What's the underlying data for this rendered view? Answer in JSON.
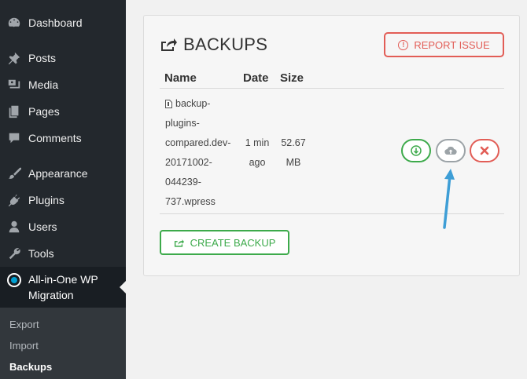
{
  "sidebar": {
    "items": [
      {
        "label": "Dashboard",
        "icon": "dashboard-icon"
      },
      {
        "label": "Posts",
        "icon": "pin-icon"
      },
      {
        "label": "Media",
        "icon": "media-icon"
      },
      {
        "label": "Pages",
        "icon": "pages-icon"
      },
      {
        "label": "Comments",
        "icon": "comment-icon"
      },
      {
        "label": "Appearance",
        "icon": "brush-icon"
      },
      {
        "label": "Plugins",
        "icon": "plugin-icon"
      },
      {
        "label": "Users",
        "icon": "user-icon"
      },
      {
        "label": "Tools",
        "icon": "wrench-icon"
      }
    ],
    "migration": {
      "label_line1": "All-in-One WP",
      "label_line2": "Migration",
      "icon": "migration-icon"
    },
    "submenu": [
      {
        "label": "Export"
      },
      {
        "label": "Import"
      },
      {
        "label": "Backups",
        "current": true
      }
    ]
  },
  "panel": {
    "title": "BACKUPS",
    "report_label": "REPORT ISSUE",
    "report_icon_glyph": "!",
    "columns": [
      "Name",
      "Date",
      "Size"
    ],
    "backup": {
      "name_lines": [
        "backup-",
        "plugins-",
        "compared.dev-",
        "20171002-",
        "044239-",
        "737.wpress"
      ],
      "date_lines": [
        "1 min",
        "ago"
      ],
      "size_lines": [
        "52.67",
        "MB"
      ]
    },
    "create_label": "CREATE BACKUP",
    "colors": {
      "green": "#3daa4b",
      "red": "#e25d56",
      "gray": "#9ca3a7",
      "arrow": "#3e9ed6"
    }
  }
}
